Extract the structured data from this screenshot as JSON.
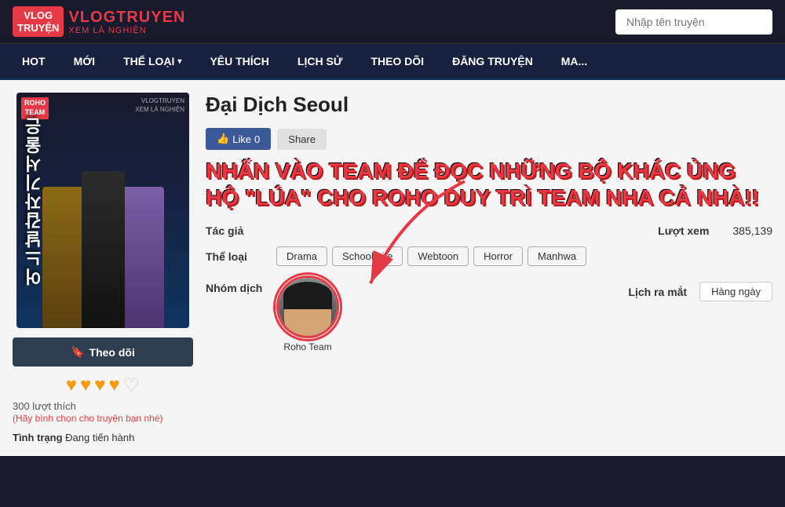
{
  "logo": {
    "icon_line1": "VLOG",
    "icon_line2": "TRUYỆN",
    "main": "VLOGTRUYEN",
    "sub": "XEM LÀ NGHIỆN"
  },
  "search": {
    "placeholder": "Nhập tên truyện"
  },
  "nav": {
    "items": [
      {
        "label": "HOT",
        "has_arrow": false
      },
      {
        "label": "MỚI",
        "has_arrow": false
      },
      {
        "label": "THỂ LOẠI",
        "has_arrow": true
      },
      {
        "label": "YÊU THÍCH",
        "has_arrow": false
      },
      {
        "label": "LỊCH SỬ",
        "has_arrow": false
      },
      {
        "label": "THEO DÕI",
        "has_arrow": false
      },
      {
        "label": "ĐĂNG TRUYỆN",
        "has_arrow": false
      },
      {
        "label": "MA...",
        "has_arrow": false
      }
    ]
  },
  "manga": {
    "title": "Đại Dịch Seoul",
    "cover": {
      "roho_badge_line1": "ROHO",
      "roho_badge_line2": "TEAM",
      "korean_title": "어느날갑자기서울은",
      "watermark_line1": "VLOGTRUYEN",
      "watermark_line2": "XEM LÀ NGHIỆN"
    },
    "like_count": "0",
    "like_label": "Like",
    "share_label": "Share",
    "promo_text_line1": "NHẤN VÀO TEAM ĐỂ ĐỌC NHỮNG BỘ KHÁC ỦNG",
    "promo_text_line2": "HỘ \"LÚA\" CHO ROHO DUY TRÌ TEAM NHA CẢ NHÀ!!",
    "author_label": "Tác giả",
    "author_value": "",
    "genre_label": "Thể loại",
    "genres": [
      "Drama",
      "School Life",
      "Webtoon",
      "Horror",
      "Manhwa"
    ],
    "translator_label": "Nhóm dịch",
    "translator_name": "Roho Team",
    "views_label": "Lượt xem",
    "views_value": "385,139",
    "release_label": "Lịch ra mắt",
    "release_value": "Hàng ngày",
    "follow_btn": "Theo dõi",
    "stars_filled": 4,
    "stars_total": 5,
    "rating_count": "300 lượt thích",
    "rating_hint": "(Hãy bình chọn cho truyện bạn nhé)",
    "status_label": "Tình trạng",
    "status_value": "Đang tiến hành"
  }
}
